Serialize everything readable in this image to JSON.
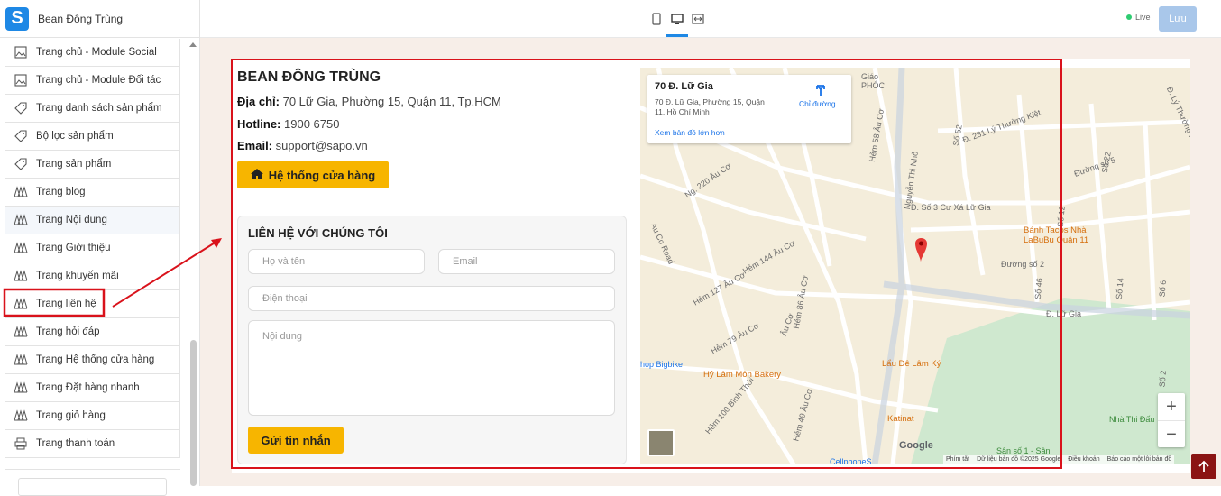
{
  "sidebar": {
    "title": "Bean Đông Trùng",
    "items": [
      {
        "label": "Trang chủ - Module Social",
        "icon": "image-icon"
      },
      {
        "label": "Trang chủ - Module Đối tác",
        "icon": "image-icon"
      },
      {
        "label": "Trang danh sách sản phẩm",
        "icon": "tag-icon"
      },
      {
        "label": "Bộ lọc sản phẩm",
        "icon": "tag-icon"
      },
      {
        "label": "Trang sản phẩm",
        "icon": "tag-icon"
      },
      {
        "label": "Trang blog",
        "icon": "page-icon"
      },
      {
        "label": "Trang Nội dung",
        "icon": "page-icon"
      },
      {
        "label": "Trang Giới thiệu",
        "icon": "page-icon"
      },
      {
        "label": "Trang khuyến mãi",
        "icon": "page-icon"
      },
      {
        "label": "Trang liên hệ",
        "icon": "page-icon"
      },
      {
        "label": "Trang hỏi đáp",
        "icon": "page-icon"
      },
      {
        "label": "Trang Hệ thống cửa hàng",
        "icon": "page-icon"
      },
      {
        "label": "Trang Đặt hàng nhanh",
        "icon": "page-icon"
      },
      {
        "label": "Trang giỏ hàng",
        "icon": "page-icon"
      },
      {
        "label": "Trang thanh toán",
        "icon": "printer-icon"
      }
    ]
  },
  "topbar": {
    "live_label": "Live",
    "save_label": "Lưu"
  },
  "contact": {
    "shop_name": "BEAN ĐÔNG TRÙNG",
    "address_label": "Địa chỉ:",
    "address": "70 Lữ Gia, Phường 15, Quận 11, Tp.HCM",
    "hotline_label": "Hotline:",
    "hotline": "1900 6750",
    "email_label": "Email:",
    "email": "support@sapo.vn",
    "stores_button": "Hệ thống cửa hàng"
  },
  "form": {
    "title": "LIÊN HỆ VỚI CHÚNG TÔI",
    "name_placeholder": "Họ và tên",
    "email_placeholder": "Email",
    "phone_placeholder": "Điện thoại",
    "content_placeholder": "Nội dung",
    "submit_label": "Gửi tin nhắn"
  },
  "map": {
    "card_title": "70 Đ. Lữ Gia",
    "card_address": "70 Đ. Lữ Gia, Phường 15, Quận 11, Hồ Chí Minh",
    "directions_label": "Chỉ đường",
    "larger_map_label": "Xem bản đồ lớn hơn",
    "zoom_in": "+",
    "zoom_out": "−",
    "google_label": "Google",
    "attribution": [
      "Phím tắt",
      "Dữ liệu bản đồ ©2025 Google",
      "Điều khoản",
      "Báo cáo một lỗi bản đồ"
    ],
    "street_labels": [
      "Đ. 281 Lý Thường Kiệt",
      "Đ. Số 3 Cư Xá Lữ Gia",
      "Đ. Lữ Gia",
      "Nguyễn Thị Nhỏ",
      "Âu Cơ",
      "Đường số 2",
      "Hẻm 144 Âu Cơ",
      "Hẻm 127 Âu Cơ",
      "Hẻm 79 Âu Cơ",
      "Hẻm 86 Âu Cơ",
      "Đ. Lý Thường Kiệt",
      "Ng. 220 Âu Cơ",
      "Hẻm 58 Âu Cơ",
      "Hẻm 100 Bình Thới",
      "Hẻm 49 Âu Cơ",
      "Au Co Road",
      "Đường số 5",
      "Số 52",
      "Số 22",
      "Số 46",
      "Số 12",
      "Số 14",
      "Số 6",
      "Số 2"
    ],
    "pois": [
      "Bánh Tacos Nhà LaBuBu Quận 11",
      "Hỷ Lâm Môn Bakery",
      "Lẩu Dê Lâm Ký",
      "Katinat",
      "hop Bigbike",
      "Nhà Thi Đấu",
      "Sân số 1 - Sân",
      "CellphoneS",
      "Giáo PHÓC"
    ]
  }
}
